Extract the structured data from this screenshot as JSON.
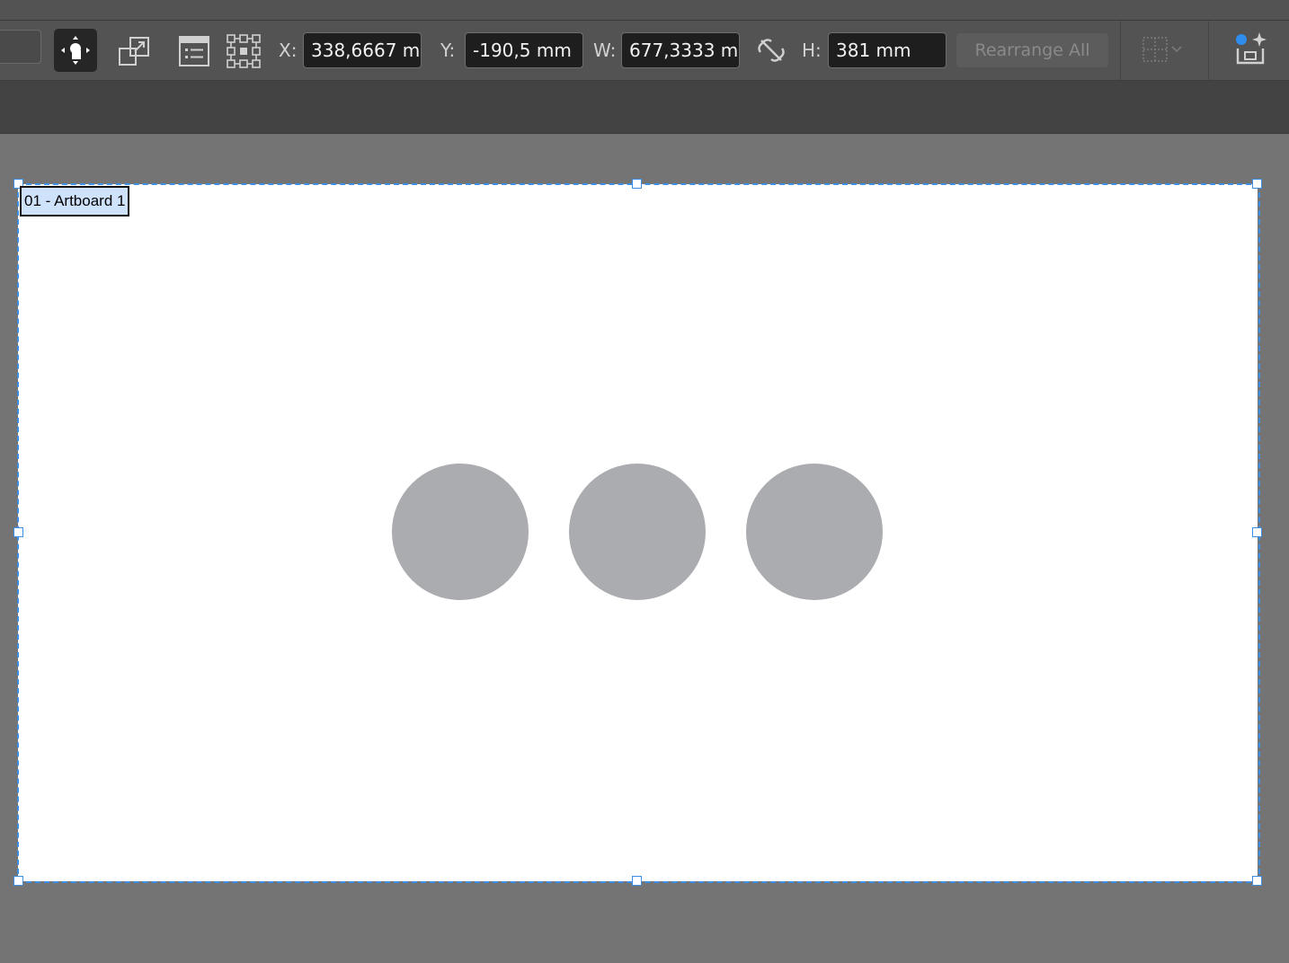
{
  "toolbar": {
    "x_label": "X:",
    "x_value": "338,6667 m",
    "y_label": "Y:",
    "y_value": "-190,5 mm",
    "w_label": "W:",
    "w_value": "677,3333 m",
    "h_label": "H:",
    "h_value": "381 mm",
    "rearrange_label": "Rearrange All"
  },
  "artboard": {
    "label": "01 - Artboard 1",
    "background": "#ffffff",
    "selection_color": "#3d8fe6"
  },
  "shapes": {
    "circle_color": "#aaacb0",
    "count": 3
  },
  "icons": {
    "artboard_tool": "move-artboard-icon",
    "move_copy": "move-copy-artwork-icon",
    "artboard_options": "artboard-options-icon",
    "reference_point": "reference-point-icon",
    "constrain": "unlink-proportions-icon",
    "align": "align-grid-icon",
    "generative": "generative-expand-icon"
  }
}
